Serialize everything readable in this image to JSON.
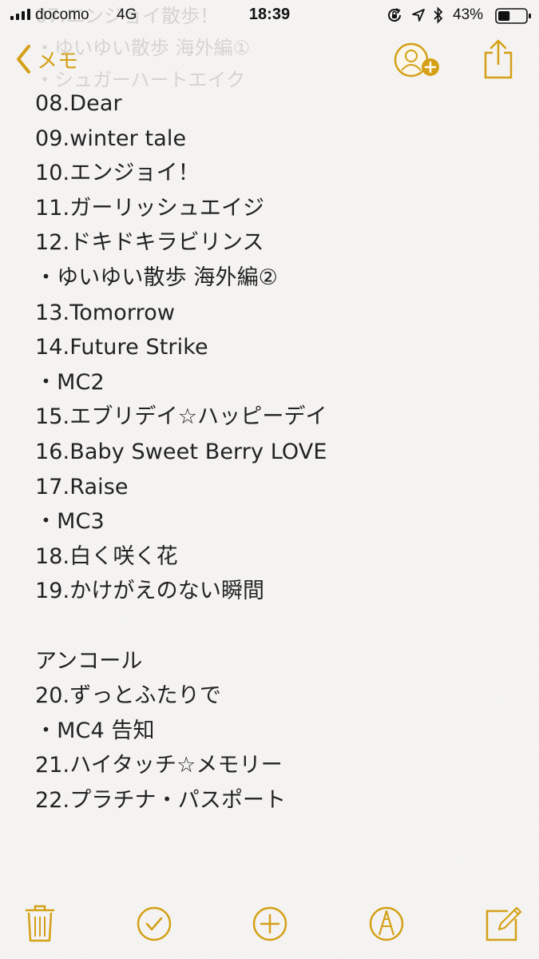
{
  "status_bar": {
    "carrier": "docomo",
    "network": "4G",
    "time": "18:39",
    "battery_percent": "43%",
    "battery_level": 0.43
  },
  "ghost_lines": [
    "07.エンジョイ散歩！",
    "・ゆいゆい散歩 海外編①",
    "・シュガーハートエイク"
  ],
  "nav": {
    "back_label": "メモ",
    "accent_color": "#d4a017",
    "icons": {
      "back": "chevron-left-icon",
      "add_person": "add-person-icon",
      "share": "share-icon"
    }
  },
  "note": {
    "lines": [
      "08.Dear",
      "09.winter tale",
      "10.エンジョイ！",
      "11.ガーリッシュエイジ",
      "12.ドキドキラビリンス",
      "・ゆいゆい散歩 海外編②",
      "13.Tomorrow",
      "14.Future Strike",
      "・MC2",
      "15.エブリデイ☆ハッピーデイ",
      "16.Baby Sweet Berry LOVE",
      "17.Raise",
      "・MC3",
      "18.白く咲く花",
      "19.かけがえのない瞬間",
      "",
      "アンコール",
      "20.ずっとふたりで",
      "・MC4 告知",
      "21.ハイタッチ☆メモリー",
      "22.プラチナ・パスポート"
    ]
  },
  "toolbar": {
    "icons": [
      "trash-icon",
      "checklist-icon",
      "add-icon",
      "markup-pen-icon",
      "compose-icon"
    ]
  }
}
